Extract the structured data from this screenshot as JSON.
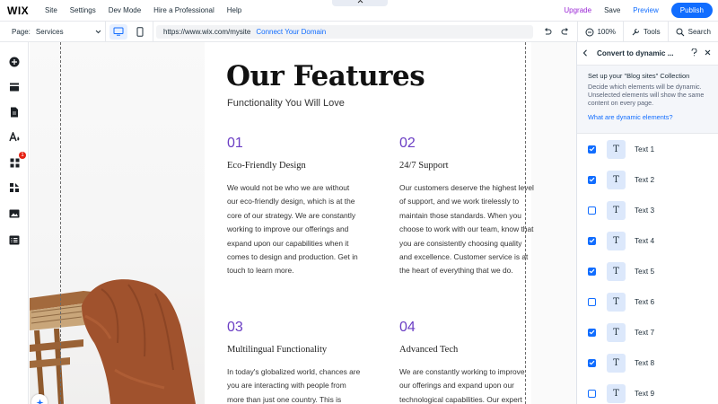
{
  "app": {
    "logo": "WIX",
    "top_tab_icon": "chevron-up-icon"
  },
  "menu": [
    "Site",
    "Settings",
    "Dev Mode",
    "Hire a Professional",
    "Help"
  ],
  "top_actions": {
    "upgrade": "Upgrade",
    "save": "Save",
    "preview": "Preview",
    "publish": "Publish"
  },
  "toolbar": {
    "page_label": "Page:",
    "page_value": "Services",
    "url": "https://www.wix.com/mysite",
    "connect_domain": "Connect Your Domain",
    "zoom": "100%",
    "tools": "Tools",
    "search": "Search"
  },
  "left_rail": {
    "icons": [
      "add-icon",
      "sections-icon",
      "pages-icon",
      "design-icon",
      "apps-icon",
      "business-icon",
      "media-icon",
      "cms-icon"
    ],
    "apps_badge": "1"
  },
  "canvas": {
    "title": "Our Features",
    "subtitle": "Functionality You Will Love",
    "features": [
      {
        "num": "01",
        "name": "Eco-Friendly Design",
        "desc": "We would not be who we are without our eco-friendly design, which is at the core of our strategy. We are constantly working to improve our offerings and expand upon our capabilities when it comes to design and production. Get in touch to learn more."
      },
      {
        "num": "02",
        "name": "24/7 Support",
        "desc": "Our customers deserve the highest level of support, and we work tirelessly to maintain those standards. When you choose to work with our team, know that you are consistently choosing quality and excellence. Customer service is at the heart of everything that we do."
      },
      {
        "num": "03",
        "name": "Multilingual Functionality",
        "desc": "In today's globalized world, chances are you are interacting with people from more than just one country. This is"
      },
      {
        "num": "04",
        "name": "Advanced Tech",
        "desc": "We are constantly working to improve our offerings and expand upon our technological capabilities. Our expert"
      }
    ]
  },
  "panel": {
    "title": "Convert to dynamic ...",
    "heading": "Set up your \"Blog sites\" Collection",
    "description": "Decide which elements will be dynamic. Unselected elements will show the same content on every page.",
    "link": "What are dynamic elements?",
    "items": [
      {
        "label": "Text 1",
        "checked": true
      },
      {
        "label": "Text 2",
        "checked": true
      },
      {
        "label": "Text 3",
        "checked": false
      },
      {
        "label": "Text 4",
        "checked": true
      },
      {
        "label": "Text 5",
        "checked": true
      },
      {
        "label": "Text 6",
        "checked": false
      },
      {
        "label": "Text 7",
        "checked": true
      },
      {
        "label": "Text 8",
        "checked": true
      },
      {
        "label": "Text 9",
        "checked": false
      }
    ],
    "item_icon_glyph": "T"
  },
  "colors": {
    "accent": "#116dff",
    "upgrade": "#9a27d5",
    "feature_number": "#6b3ec4",
    "badge": "#e62214"
  }
}
